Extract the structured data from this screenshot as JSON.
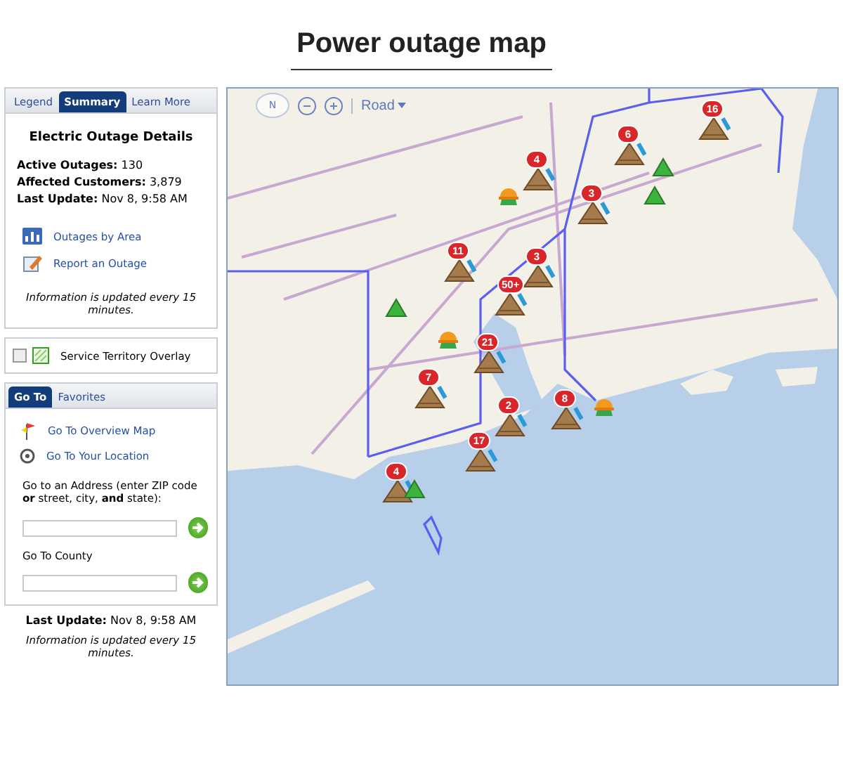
{
  "title": "Power outage map",
  "summary_panel": {
    "tabs": [
      {
        "label": "Legend",
        "selected": false
      },
      {
        "label": "Summary",
        "selected": true
      },
      {
        "label": "Learn More",
        "selected": false
      }
    ],
    "heading": "Electric Outage Details",
    "stats": [
      "**Active Outages:** 130",
      "**Affected Customers:** 3,879",
      "**Last Update:** Nov 8, 9:58 AM"
    ],
    "links": [
      {
        "kind": "area",
        "label": "Outages by Area"
      },
      {
        "kind": "report",
        "label": "Report an Outage"
      }
    ],
    "note": "Information is updated every 15 minutes."
  },
  "overlay": {
    "label": "Service Territory Overlay",
    "checked": false
  },
  "goto_panel": {
    "tabs": [
      {
        "label": "Go To",
        "selected": true
      },
      {
        "label": "Favorites",
        "selected": false
      }
    ],
    "links": [
      {
        "kind": "overview",
        "label": "Go To Overview Map"
      },
      {
        "kind": "location",
        "label": "Go To Your Location"
      }
    ],
    "address_label": "Go to an Address (enter ZIP code **or** street, city, **and** state):",
    "county_label": "Go To County"
  },
  "footer": {
    "last_update": "**Last Update:** Nov 8, 9:58 AM",
    "note": "Information is updated every 15 minutes."
  },
  "map": {
    "compass_label": "N",
    "map_type": "Road",
    "markers": [
      {
        "kind": "outage",
        "count": "16"
      },
      {
        "kind": "outage",
        "count": "6"
      },
      {
        "kind": "outage",
        "count": "4"
      },
      {
        "kind": "outage",
        "count": "3"
      },
      {
        "kind": "outage",
        "count": "11"
      },
      {
        "kind": "outage",
        "count": "3"
      },
      {
        "kind": "outage",
        "count": "50+"
      },
      {
        "kind": "outage",
        "count": "21"
      },
      {
        "kind": "outage",
        "count": "7"
      },
      {
        "kind": "outage",
        "count": "2"
      },
      {
        "kind": "outage",
        "count": "8"
      },
      {
        "kind": "outage",
        "count": "17"
      },
      {
        "kind": "outage",
        "count": "4"
      },
      {
        "kind": "restored"
      },
      {
        "kind": "restored"
      },
      {
        "kind": "restored"
      },
      {
        "kind": "restored"
      },
      {
        "kind": "crew"
      },
      {
        "kind": "crew"
      },
      {
        "kind": "crew"
      }
    ]
  }
}
